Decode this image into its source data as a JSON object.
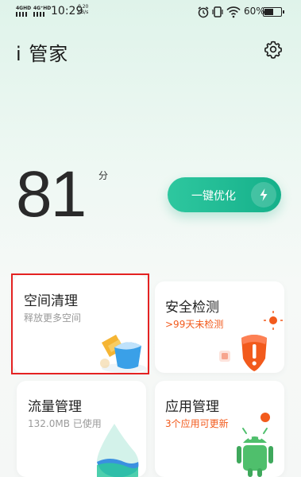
{
  "status_bar": {
    "sim1": "4GHD",
    "sim2": "4G⁺HD",
    "time": "10:29",
    "net_speed": "0.20",
    "net_unit": "KB/s",
    "battery_percent": "60%",
    "battery_level": 0.6
  },
  "header": {
    "title": "i 管家",
    "settings_icon": "gear-icon"
  },
  "score": {
    "value": "81",
    "unit": "分"
  },
  "optimize": {
    "label": "一键优化",
    "icon": "lightning-icon"
  },
  "cards": [
    {
      "title": "空间清理",
      "subtitle": "释放更多空间",
      "icon": "storage-cleaning-icon",
      "accent": "#3aa0e8"
    },
    {
      "title": "安全检测",
      "subtitle": ">99天未检测",
      "icon": "security-shield-icon",
      "accent": "#f25a1c"
    },
    {
      "title": "流量管理",
      "subtitle": "132.0MB 已使用",
      "icon": "data-drop-icon",
      "accent": "#2ec79f"
    },
    {
      "title": "应用管理",
      "subtitle": "3个应用可更新",
      "icon": "android-robot-icon",
      "accent": "#f25a1c"
    }
  ],
  "colors": {
    "primary": "#15b08a",
    "warning": "#f25a1c",
    "highlight": "#e42222"
  }
}
